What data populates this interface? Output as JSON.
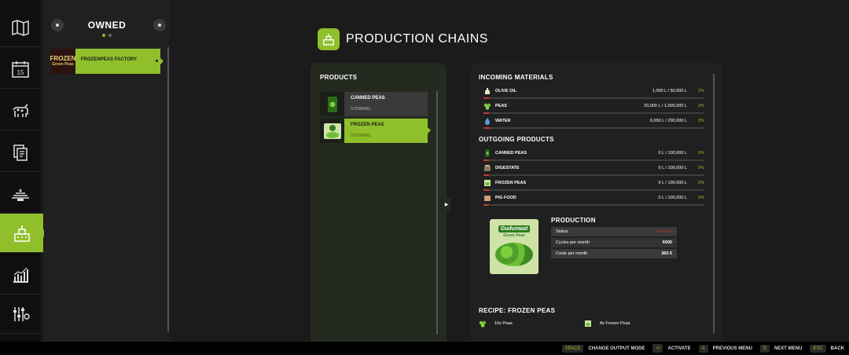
{
  "nav": {
    "items": [
      {
        "icon": "map-icon"
      },
      {
        "icon": "calendar-icon",
        "text": "15"
      },
      {
        "icon": "animals-icon"
      },
      {
        "icon": "contracts-icon"
      },
      {
        "icon": "field-icon"
      },
      {
        "icon": "production-icon",
        "active": true
      },
      {
        "icon": "statistics-icon"
      },
      {
        "icon": "settings-icon"
      }
    ]
  },
  "owned": {
    "title": "OWNED",
    "items": [
      {
        "label": "FROZENPEAS FACTORY",
        "thumb_top": "FROZEN",
        "thumb_sub": "Green Peas"
      }
    ]
  },
  "header": {
    "title": "PRODUCTION CHAINS"
  },
  "products": {
    "title": "PRODUCTS",
    "items": [
      {
        "name": "CANNED PEAS",
        "state": "STORING",
        "active": false
      },
      {
        "name": "FROZEN PEAS",
        "state": "STORING",
        "active": true
      }
    ]
  },
  "incoming": {
    "title": "INCOMING MATERIALS",
    "rows": [
      {
        "name": "OLIVE OIL",
        "amount": "1,000 L / 50,000 L",
        "pct": "2%",
        "fill": 0.02
      },
      {
        "name": "PEAS",
        "amount": "20,000 L / 1,000,000 L",
        "pct": "2%",
        "fill": 0.02
      },
      {
        "name": "WATER",
        "amount": "6,050 L / 200,000 L",
        "pct": "3%",
        "fill": 0.03
      }
    ]
  },
  "outgoing": {
    "title": "OUTGOING PRODUCTS",
    "rows": [
      {
        "name": "CANNED PEAS",
        "amount": "0 L / 100,000 L",
        "pct": "0%",
        "fill": 0.0
      },
      {
        "name": "DIGESTATE",
        "amount": "0 L / 100,000 L",
        "pct": "0%",
        "fill": 0.0
      },
      {
        "name": "FROZEN PEAS",
        "amount": "0 L / 100,000 L",
        "pct": "0%",
        "fill": 0.0
      },
      {
        "name": "PIG FOOD",
        "amount": "0 L / 100,000 L",
        "pct": "0%",
        "fill": 0.0
      }
    ]
  },
  "production": {
    "title": "PRODUCTION",
    "product_brand": "Gudumaat",
    "product_sub": "Green Peas",
    "status_label": "Status",
    "status_value": "Inactive",
    "cycles_label": "Cycles per month",
    "cycles_value": "6000",
    "costs_label": "Costs per month",
    "costs_value": "360 €"
  },
  "recipe": {
    "title": "RECIPE: FROZEN PEAS",
    "input": "10x Peas",
    "output": "8x Frozen Peas"
  },
  "bottombar": {
    "hints": [
      {
        "key": "SPACE",
        "label": "CHANGE OUTPUT MODE"
      },
      {
        "key": "⏎",
        "label": "ACTIVATE"
      },
      {
        "key": "A",
        "label": "PREVIOUS MENU"
      },
      {
        "key": "E",
        "label": "NEXT MENU"
      },
      {
        "key": "ESC",
        "label": "BACK"
      }
    ]
  },
  "colors": {
    "accent": "#8fbf2a",
    "warning": "#c0392b",
    "background": "#1b1b1b"
  }
}
